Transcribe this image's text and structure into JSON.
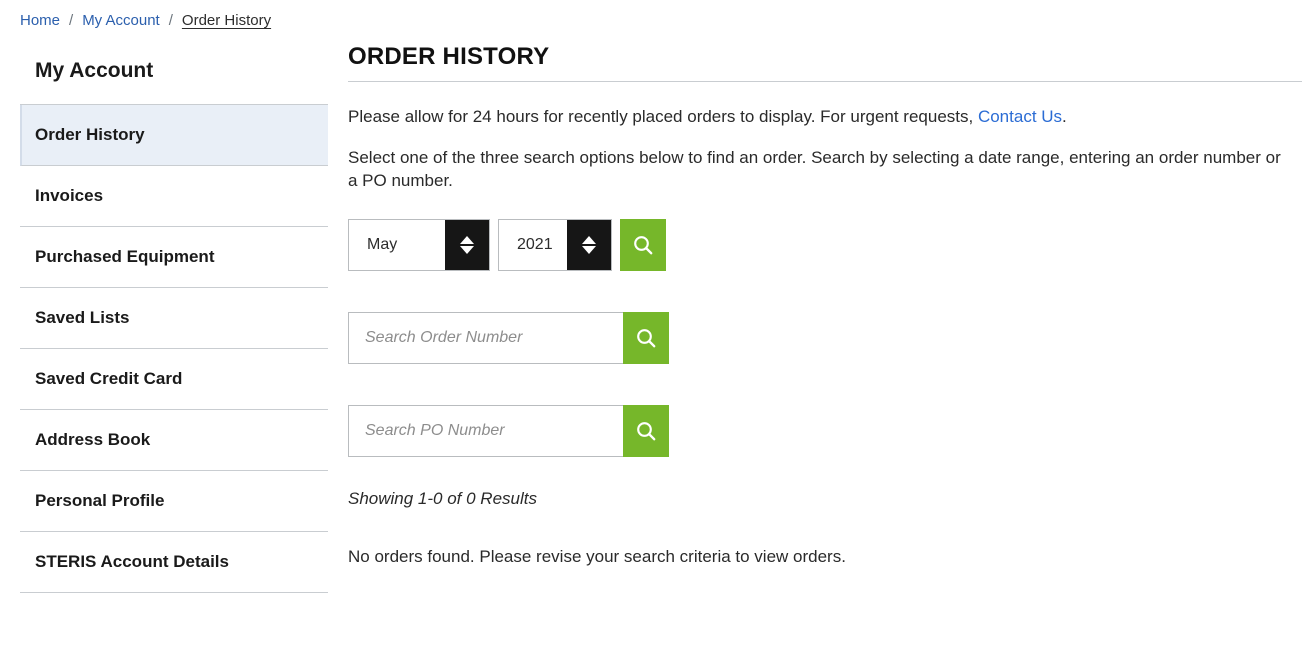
{
  "breadcrumb": {
    "items": [
      {
        "label": "Home",
        "type": "link"
      },
      {
        "label": "My Account",
        "type": "link"
      },
      {
        "label": "Order History",
        "type": "current"
      }
    ],
    "separator": "/"
  },
  "sidebar": {
    "title": "My Account",
    "items": [
      {
        "label": "Order History",
        "active": true
      },
      {
        "label": "Invoices",
        "active": false
      },
      {
        "label": "Purchased Equipment",
        "active": false
      },
      {
        "label": "Saved Lists",
        "active": false
      },
      {
        "label": "Saved Credit Card",
        "active": false
      },
      {
        "label": "Address Book",
        "active": false
      },
      {
        "label": "Personal Profile",
        "active": false
      },
      {
        "label": "STERIS Account Details",
        "active": false
      }
    ]
  },
  "main": {
    "title": "ORDER HISTORY",
    "intro_1_before": "Please allow for 24 hours for recently placed orders to display. For urgent requests, ",
    "intro_1_link": "Contact Us",
    "intro_1_after": ".",
    "intro_2": "Select one of the three search options below to find an order. Search by selecting a date range, entering an order number or a PO number.",
    "date_search": {
      "month_value": "May",
      "year_value": "2021",
      "month_spinner_icon": "up-down-spinner-icon",
      "year_spinner_icon": "up-down-spinner-icon",
      "search_icon": "search-icon"
    },
    "order_search": {
      "value": "",
      "placeholder": "Search Order Number",
      "search_icon": "search-icon"
    },
    "po_search": {
      "value": "",
      "placeholder": "Search PO Number",
      "search_icon": "search-icon"
    },
    "results_count": "Showing 1-0 of 0 Results",
    "no_orders_message": "No orders found. Please revise your search criteria to view orders."
  },
  "colors": {
    "accent_green": "#76b72a",
    "link_blue": "#2b6cd4",
    "breadcrumb_blue": "#2b5fad",
    "active_nav_bg": "#e9eff7",
    "spinner_bg": "#161616",
    "border_gray": "#c9cdd1"
  }
}
